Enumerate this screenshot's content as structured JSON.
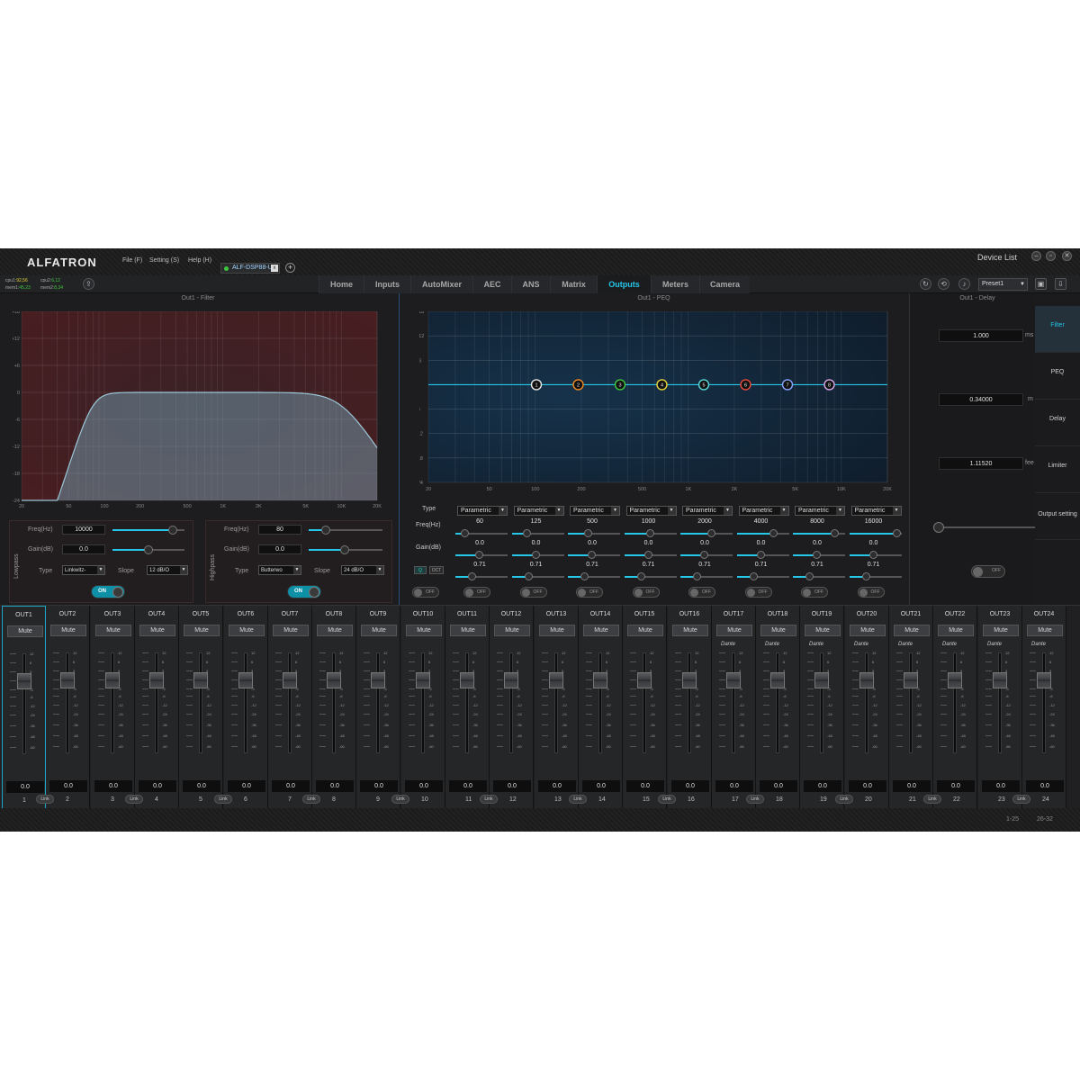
{
  "app": {
    "logo": "ALFATRON",
    "menus": [
      "File (F)",
      "Setting (S)",
      "Help (H)"
    ],
    "device_tab": "ALF-DSP88-U",
    "device_tab_close": "x",
    "add_tab": "+",
    "device_list": "Device List",
    "window_buttons": [
      "–",
      "▫",
      "✕"
    ]
  },
  "status": {
    "cpu1_label": "cpu1:",
    "cpu1_value": "92,56",
    "cpu2_label": "cpu2:",
    "cpu2_value": "6,12",
    "mem1_label": "mem1:",
    "mem1_value": "45,23",
    "mem2_label": "mem2:",
    "mem2_value": "8,34"
  },
  "nav": {
    "tabs": [
      "Home",
      "Inputs",
      "AutoMixer",
      "AEC",
      "ANS",
      "Matrix",
      "Outputs",
      "Meters",
      "Camera"
    ],
    "active": "Outputs",
    "preset": "Preset1"
  },
  "filter": {
    "title": "Out1 - Filter",
    "y_ticks": [
      "+18",
      "+12",
      "+6",
      "0",
      "-6",
      "-12",
      "-18",
      "-24"
    ],
    "x_ticks": [
      "20",
      "50",
      "100",
      "200",
      "500",
      "1K",
      "2K",
      "5K",
      "10K",
      "20K"
    ],
    "lowpass": {
      "label": "Lowpass",
      "freq_label": "Freq(Hz)",
      "freq": "10000",
      "freq_pos": 0.82,
      "gain_label": "Gain(dB)",
      "gain": "0.0",
      "gain_pos": 0.5,
      "type_label": "Type",
      "type": "Linkwitz-",
      "slope_label": "Slope",
      "slope": "12 dB/O",
      "toggle": "ON"
    },
    "highpass": {
      "label": "Highpass",
      "freq_label": "Freq(Hz)",
      "freq": "80",
      "freq_pos": 0.2,
      "gain_label": "Gain(dB)",
      "gain": "0.0",
      "gain_pos": 0.5,
      "type_label": "Type",
      "type": "Butterwo",
      "slope_label": "Slope",
      "slope": "24 dB/O",
      "toggle": "ON"
    }
  },
  "peq": {
    "title": "Out1 - PEQ",
    "y_ticks": [
      "+18",
      "+12",
      "+6",
      "0",
      "-6",
      "-12",
      "-18",
      "-24"
    ],
    "x_ticks": [
      "20",
      "50",
      "100",
      "200",
      "500",
      "1K",
      "2K",
      "5K",
      "10K",
      "20K"
    ],
    "row_labels": {
      "type": "Type",
      "freq": "Freq(Hz)",
      "gain": "Gain(dB)"
    },
    "q_label": "Q",
    "oct_label": "OCT",
    "bands": [
      {
        "n": "1",
        "type": "Parametric",
        "freq": "60",
        "gain": "0.0",
        "q": "0.71",
        "toggle": "OFF",
        "color": "#e6e6e6",
        "freq_pos": 0.25
      },
      {
        "n": "2",
        "type": "Parametric",
        "freq": "125",
        "gain": "0.0",
        "q": "0.71",
        "toggle": "OFF",
        "color": "#f08a24",
        "freq_pos": 0.35
      },
      {
        "n": "3",
        "type": "Parametric",
        "freq": "500",
        "gain": "0.0",
        "q": "0.71",
        "toggle": "OFF",
        "color": "#3ec83e",
        "freq_pos": 0.55
      },
      {
        "n": "4",
        "type": "Parametric",
        "freq": "1000",
        "gain": "0.0",
        "q": "0.71",
        "toggle": "OFF",
        "color": "#e6d43a",
        "freq_pos": 0.65
      },
      {
        "n": "5",
        "type": "Parametric",
        "freq": "2000",
        "gain": "0.0",
        "q": "0.71",
        "toggle": "OFF",
        "color": "#5ad8d8",
        "freq_pos": 0.75
      },
      {
        "n": "6",
        "type": "Parametric",
        "freq": "4000",
        "gain": "0.0",
        "q": "0.71",
        "toggle": "OFF",
        "color": "#e84a3a",
        "freq_pos": 0.85
      },
      {
        "n": "7",
        "type": "Parametric",
        "freq": "8000",
        "gain": "0.0",
        "q": "0.71",
        "toggle": "OFF",
        "color": "#8aa4ff",
        "freq_pos": 0.92
      },
      {
        "n": "8",
        "type": "Parametric",
        "freq": "16000",
        "gain": "0.0",
        "q": "0.71",
        "toggle": "OFF",
        "color": "#d8a8e8",
        "freq_pos": 0.98
      }
    ]
  },
  "delay": {
    "title": "Out1 - Delay",
    "ms": "1.000",
    "ms_unit": "ms",
    "m": "0.34000",
    "m_unit": "m",
    "feet": "1.11520",
    "feet_unit": "fee",
    "toggle": "OFF"
  },
  "side_tabs": [
    "Filter",
    "PEQ",
    "Delay",
    "Limiter",
    "Output setting"
  ],
  "side_active": "Filter",
  "channels": {
    "mute_label": "Mute",
    "link_label": "Link",
    "dante_label": "Dante",
    "scale": [
      "12",
      "6",
      "3",
      "0",
      "-3",
      "-6",
      "-12",
      "-24",
      "-36",
      "-48",
      "-60"
    ],
    "names": [
      "OUT1",
      "OUT2",
      "OUT3",
      "OUT4",
      "OUT5",
      "OUT6",
      "OUT7",
      "OUT8",
      "OUT9",
      "OUT10",
      "OUT11",
      "OUT12",
      "OUT13",
      "OUT14",
      "OUT15",
      "OUT16",
      "OUT17",
      "OUT18",
      "OUT19",
      "OUT20",
      "OUT21",
      "OUT22",
      "OUT23",
      "OUT24"
    ],
    "values": [
      "0.0",
      "0.0",
      "0.0",
      "0.0",
      "0.0",
      "0.0",
      "0.0",
      "0.0",
      "0.0",
      "0.0",
      "0.0",
      "0.0",
      "0.0",
      "0.0",
      "0.0",
      "0.0",
      "0.0",
      "0.0",
      "0.0",
      "0.0",
      "0.0",
      "0.0",
      "0.0",
      "0.0"
    ],
    "numbers": [
      "1",
      "2",
      "3",
      "4",
      "5",
      "6",
      "7",
      "8",
      "9",
      "10",
      "11",
      "12",
      "13",
      "14",
      "15",
      "16",
      "17",
      "18",
      "19",
      "20",
      "21",
      "22",
      "23",
      "24"
    ],
    "dante_from": 16
  },
  "pager": [
    "1-25",
    "26-32"
  ]
}
